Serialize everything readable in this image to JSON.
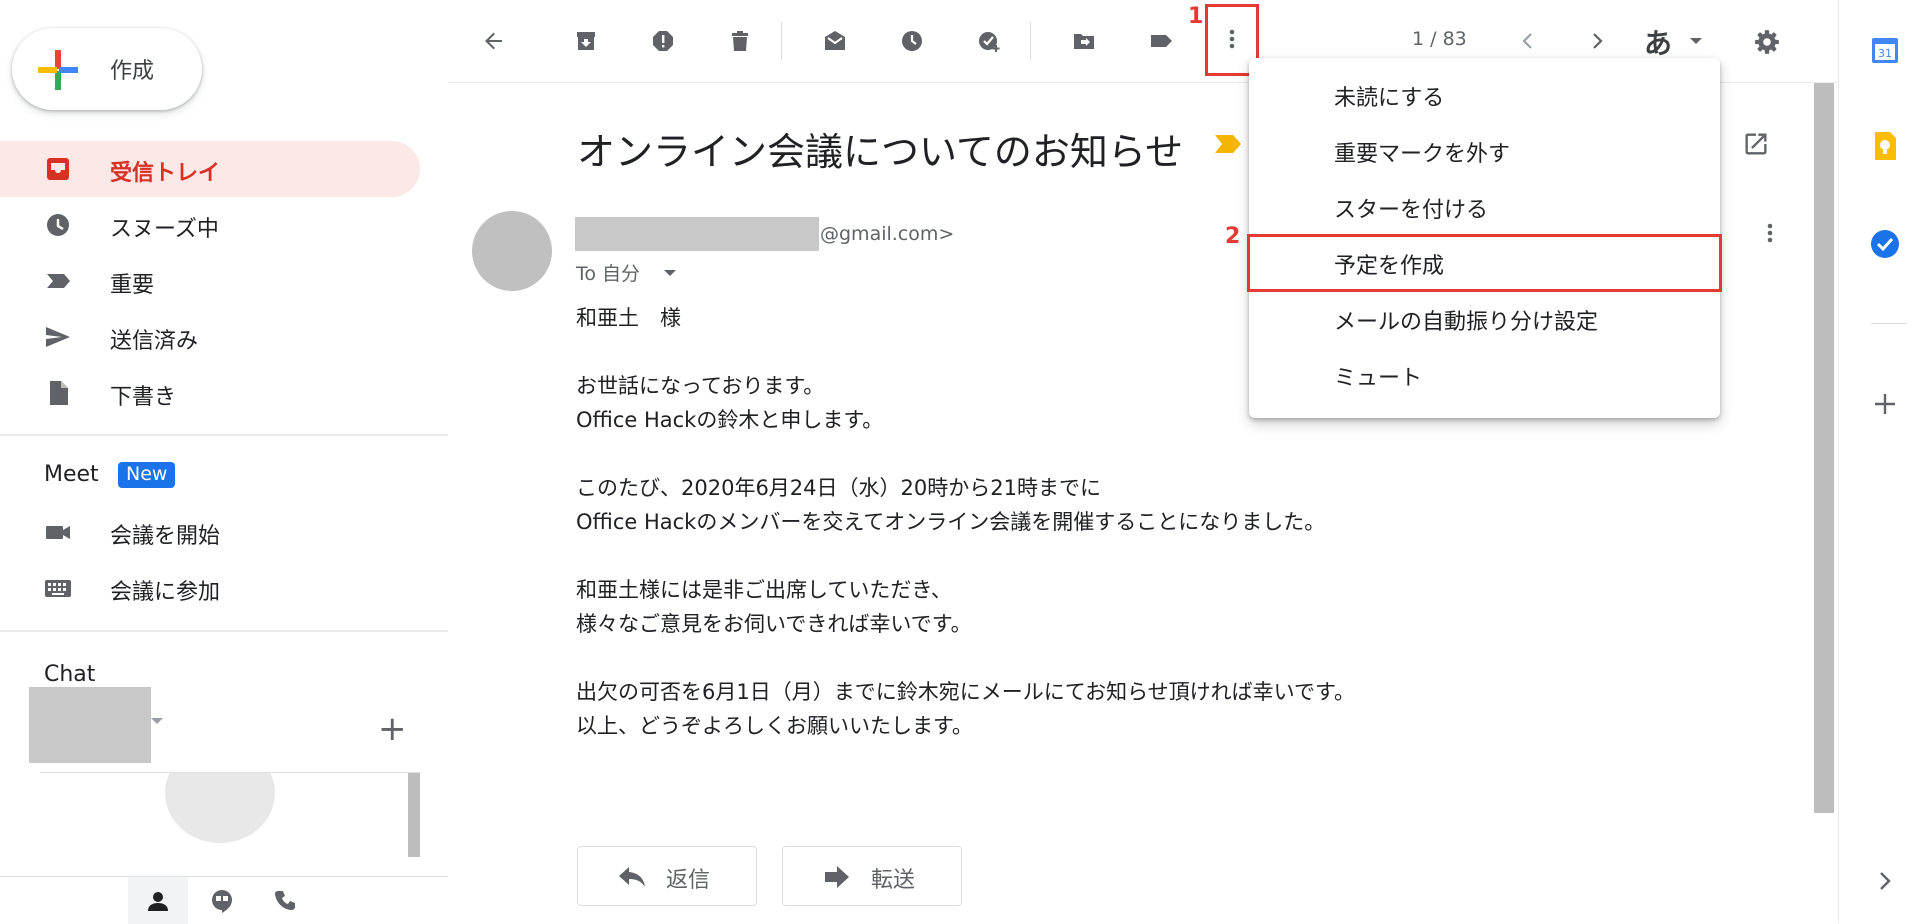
{
  "compose": {
    "label": "作成"
  },
  "sidebar": {
    "items": [
      {
        "label": "受信トレイ",
        "icon": "inbox-icon"
      },
      {
        "label": "スヌーズ中",
        "icon": "snooze-clock-icon"
      },
      {
        "label": "重要",
        "icon": "important-label-icon"
      },
      {
        "label": "送信済み",
        "icon": "send-icon"
      },
      {
        "label": "下書き",
        "icon": "draft-file-icon"
      }
    ]
  },
  "meet": {
    "title": "Meet",
    "badge": "New",
    "items": [
      {
        "label": "会議を開始",
        "icon": "videocam-icon"
      },
      {
        "label": "会議に参加",
        "icon": "keyboard-icon"
      }
    ]
  },
  "chat": {
    "title": "Chat",
    "add_symbol": "+"
  },
  "toolbar": {
    "page_count": "1 / 83",
    "lang_label": "あ",
    "annotation_1": "1",
    "annotation_2": "2"
  },
  "message": {
    "subject": "オンライン会議についてのお知らせ",
    "sender_email": "@gmail.com>",
    "to_line": "To 自分",
    "body": [
      "和亜土　様",
      "",
      "お世話になっております。",
      "Office Hackの鈴木と申します。",
      "",
      "このたび、2020年6月24日（水）20時から21時までに",
      "Office Hackのメンバーを交えてオンライン会議を開催することになりました。",
      "",
      "和亜土様には是非ご出席していただき、",
      "様々なご意見をお伺いできれば幸いです。",
      "",
      "出欠の可否を6月1日（月）までに鈴木宛にメールにてお知らせ頂ければ幸いです。",
      "以上、どうぞよろしくお願いいたします。"
    ],
    "reply_label": "返信",
    "forward_label": "転送"
  },
  "menu": {
    "items": [
      "未読にする",
      "重要マークを外す",
      "スターを付ける",
      "予定を作成",
      "メールの自動振り分け設定",
      "ミュート"
    ]
  },
  "colors": {
    "accent_red": "#d93025",
    "active_bg": "#fce8e6",
    "highlight_red": "#e53935",
    "meet_badge": "#1a73e8"
  }
}
